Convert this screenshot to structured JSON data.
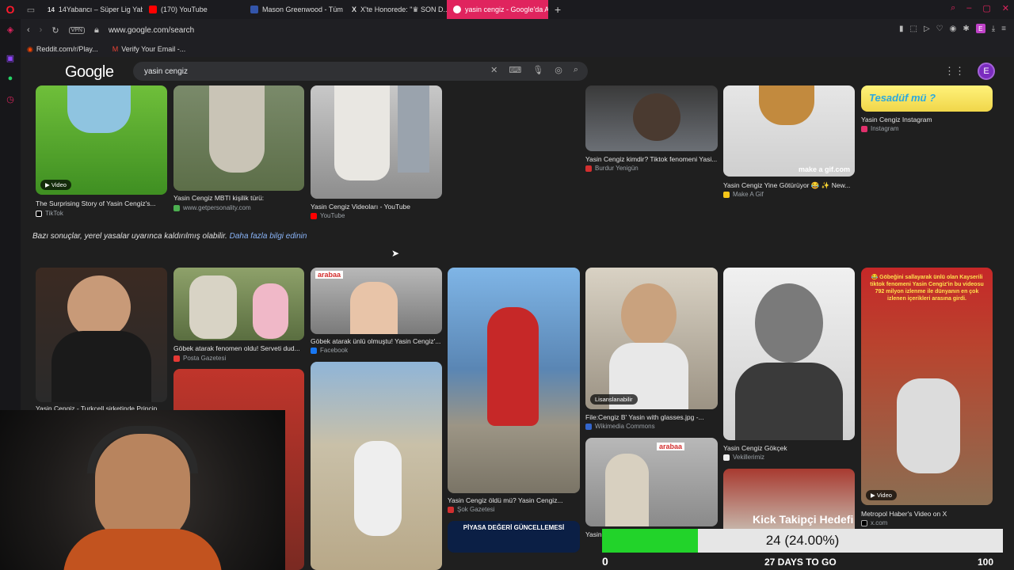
{
  "tabs": [
    {
      "label": "14Yabancı – Süper Lig Yaba",
      "icon": "14"
    },
    {
      "label": "(170) YouTube",
      "color": "#ff0000"
    },
    {
      "label": "Mason Greenwood - Tüm ...",
      "color": "#3355aa"
    },
    {
      "label": "X'te Honorede: \"♛ SON D...",
      "icon": "X"
    },
    {
      "label": "yasin cengiz - Google'da A...",
      "color": "#ffffff"
    }
  ],
  "toolbar": {
    "vpn": "VPN",
    "url": "www.google.com/search",
    "e": "E"
  },
  "bookmarks": [
    {
      "label": "Reddit.com/r/Play...",
      "icon": "◉"
    },
    {
      "label": "Verify Your Email -...",
      "icon": "M"
    }
  ],
  "google": {
    "logo": "Google",
    "query": "yasin cengiz",
    "avatar": "E"
  },
  "results": {
    "r1": {
      "caption": "The Surprising Story of Yasin Cengiz's...",
      "source": "TikTok",
      "badge": "Video"
    },
    "r2": {
      "caption": "Yasin Cengiz MBTI kişilik türü:",
      "source": "www.getpersonality.com"
    },
    "r3": {
      "caption": "Yasin Cengiz Videoları - YouTube",
      "source": "YouTube"
    },
    "r4": {
      "caption": "Yasin Cengiz kimdir? Tiktok fenomeni Yasi...",
      "source": "Burdur Yenigün"
    },
    "r5": {
      "caption": "Yasin Cengiz Yine Götürüyor 😂 ✨ New...",
      "source": "Make A Gif",
      "watermark": "make a gif.com"
    },
    "r6": {
      "caption": "Yasin Cengiz Instagram",
      "source": "Instagram",
      "overlay": "Tesadüf mü ?"
    },
    "notice": "Bazı sonuçlar, yerel yasalar uyarınca kaldırılmış olabilir.",
    "notice_link": "Daha fazla bilgi edinin",
    "r7": {
      "caption": "Yasin Cengiz - Turkcell şirketinde Princip..."
    },
    "r8": {
      "caption": "Göbek atarak fenomen oldu! Serveti dud...",
      "source": "Posta Gazetesi"
    },
    "r9": {
      "caption": "Göbek atarak ünlü olmuştu! Yasin Cengiz'...",
      "source": "Facebook",
      "sign": "arabaa"
    },
    "r10": {
      "caption": "Yasin Cengiz öldü mü? Yasin Cengiz...",
      "source": "Şok Gazetesi"
    },
    "r11": {
      "caption": "File:Cengiz B' Yasin with glasses.jpg -...",
      "source": "Wikimedia Commons",
      "badge": "Lisanslanabilir"
    },
    "r12": {
      "caption": "Yasin Cengiz Gökçek",
      "source": "Vekillerimiz"
    },
    "r13": {
      "caption": "Metropol Haber's Video on X",
      "source": "x.com",
      "badge": "Video",
      "overlay": "😂 Göbeğini sallayarak ünlü olan Kayserili tiktok fenomeni Yasin Cengiz'in bu videosu 792 milyon izlenme ile dünyanın en çok izlenen içerikleri arasına girdi."
    },
    "r14": {
      "banner": "PİYASA DEĞERİ GÜNCELLEMESİ"
    },
    "r15": {
      "caption": "Yasin",
      "sign": "arabaa"
    }
  },
  "kick": {
    "title": "Kick Takipçi Hedefi",
    "progress_label": "24 (24.00%)",
    "progress_pct": 24,
    "min": "0",
    "days": "27 DAYS TO GO",
    "max": "100"
  }
}
